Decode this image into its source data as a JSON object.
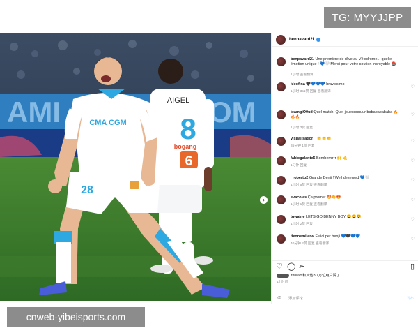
{
  "watermark_top": "TG: MYYJJPP",
  "watermark_bottom": "cnweb-yibeisports.com",
  "post": {
    "author": "benpavard21",
    "jersey_back_name": "AIGEL",
    "jersey_back_number": "8",
    "jersey_front_sponsor": "CMA CGM",
    "jersey_front_number": "28",
    "jersey_back_sponsor": "bogang",
    "jersey_back_sponsor_number": "6"
  },
  "comments": [
    {
      "user": "benpavard21",
      "text": "Une première de rêve au Vélodrome... quelle émotion unique ! 💙🤍 Merci pour votre soutien incroyable 🏟️",
      "meta": "1小时  查看翻译"
    },
    {
      "user": "kleofina",
      "text": "🖤💙💙💙 bravissimo",
      "meta": "1小时  351赞  回复  查看翻译"
    },
    {
      "user": "teamgiO0ud",
      "text": "Quel match! Quel jouexuuuuur babababababa 🔥🔥🔥",
      "meta": "1小时  3赞  回复"
    },
    {
      "user": "visualisation_",
      "text": "👏👏👏",
      "meta": "35分钟  1赞  回复"
    },
    {
      "user": "fabiogalante5",
      "text": "Bomberrrrrr 🙌 🤙",
      "meta": "1分钟  回复"
    },
    {
      "user": "_roberto2",
      "text": "Grande Benji ! Well deserved 💙🤍",
      "meta": "1小时  5赞  回复  查看翻译"
    },
    {
      "user": "evacolas",
      "text": "Ça promet 🤩👏😍",
      "meta": "1小时  1赞  回复  查看翻译"
    },
    {
      "user": "tuwaine",
      "text": "LETS GO BENNY BOY 😍😍😍",
      "meta": "1小时  2赞  回复"
    },
    {
      "user": "tiennemilano",
      "text": "Felici per benji 💙🖤💙💙",
      "meta": "40分钟  2赞  回复  查看翻译"
    }
  ],
  "likes_text": "thuram和其他3.7万位用户赞了",
  "likes_date": "1小时前",
  "add_comment_placeholder": "添加评论...",
  "post_button": "发布",
  "colors": {
    "watermark_bg": "#8c8c8c",
    "pitch": "#3d7a2f",
    "stadium_blue": "#2a3b54",
    "verified": "#3897f0",
    "kit_blue": "#2ea8e0"
  },
  "icons": [
    "heart-icon",
    "comment-icon",
    "share-icon",
    "bookmark-icon",
    "emoji-icon",
    "more-icon",
    "next-arrow-icon"
  ]
}
